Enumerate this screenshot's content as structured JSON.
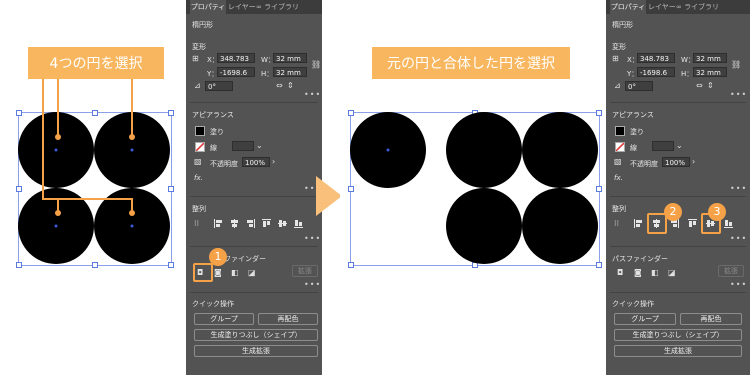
{
  "left_callout": "4つの円を選択",
  "right_callout": "元の円と合体した円を選択",
  "panel_left": {
    "tabs": [
      "プロパティ",
      "レイヤー",
      "ライブラリ"
    ],
    "object_type": "楕円形",
    "transform_label": "変形",
    "x_label": "X：",
    "x_value": "348.783",
    "w_label": "W：",
    "w_value": "32 mm",
    "y_label": "Y：",
    "y_value": "-1698.6",
    "h_label": "H：",
    "h_value": "32 mm",
    "rotate_value": "0°",
    "appearance_label": "アピアランス",
    "fill_label": "塗り",
    "stroke_label": "線",
    "opacity_label": "不透明度",
    "opacity_value": "100%",
    "fx_label": "fx.",
    "align_label": "整列",
    "pathfinder_label": "ファインダー",
    "expand_label": "拡張",
    "quick_label": "クイック操作",
    "group_button": "グループ",
    "recolor_button": "再配色",
    "generative_fill_button": "生成塗りつぶし（シェイプ）",
    "generative_expand_button": "生成拡張"
  },
  "panel_right": {
    "tabs": [
      "プロパティ",
      "レイヤー",
      "ライブラリ"
    ],
    "object_type": "楕円形",
    "transform_label": "変形",
    "x_label": "X：",
    "x_value": "348.783",
    "w_label": "W：",
    "w_value": "32 mm",
    "y_label": "Y：",
    "y_value": "-1698.6",
    "h_label": "H：",
    "h_value": "32 mm",
    "rotate_value": "0°",
    "appearance_label": "アピアランス",
    "fill_label": "塗り",
    "stroke_label": "線",
    "opacity_label": "不透明度",
    "opacity_value": "100%",
    "fx_label": "fx.",
    "align_label": "整列",
    "pathfinder_label": "パスファインダー",
    "expand_label": "拡張",
    "quick_label": "クイック操作",
    "group_button": "グループ",
    "recolor_button": "再配色",
    "generative_fill_button": "生成塗りつぶし（シェイプ）",
    "generative_expand_button": "生成拡張"
  },
  "badges": [
    "1",
    "2",
    "3"
  ],
  "icons": {
    "libraries": "cc-libraries-icon",
    "chain": "link-icon",
    "next": "arrow-right-icon"
  },
  "colors": {
    "accent": "#f5a147",
    "callout": "#f8b65e",
    "panel": "#535353",
    "selection": "#5b7bde"
  }
}
